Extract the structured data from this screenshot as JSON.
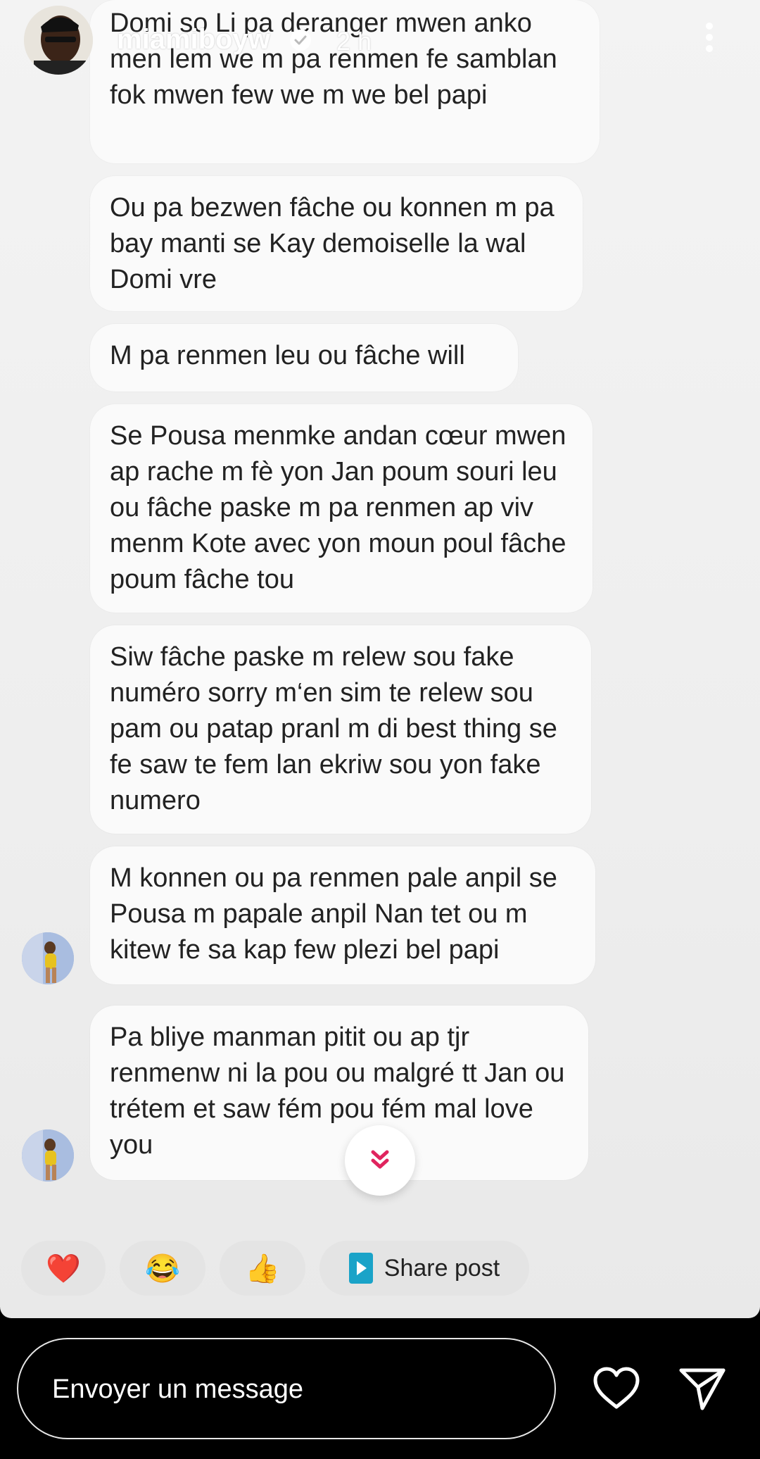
{
  "header": {
    "username": "miamiboyw",
    "time": "2 h"
  },
  "messages": [
    {
      "text": "Domi so Li pa deranger mwen anko men lem we m pa renmen fe samblan fok mwen few we m we bel papi"
    },
    {
      "text": "Ou pa bezwen fâche  ou konnen m pa bay manti se Kay demoiselle la wal Domi vre"
    },
    {
      "text": "M pa renmen leu ou fâche will"
    },
    {
      "text": "Se Pousa menmke andan cœur mwen ap rache m fè yon Jan poum souri leu ou fâche paske m pa renmen ap viv menm Kote avec yon moun poul fâche poum fâche tou"
    },
    {
      "text": "Siw fâche paske m relew sou fake numéro sorry m‘en sim te relew sou pam ou patap pranl m di best thing se fe saw te fem lan ekriw sou yon fake numero"
    },
    {
      "text": "M konnen ou pa renmen pale anpil se Pousa m papale anpil Nan tet ou m kitew fe sa kap few plezi bel papi"
    },
    {
      "text": "Pa bliye manman pitit ou ap tjr renmenw ni la pou ou malgré tt Jan ou trétem et saw fém pou fém mal love you"
    }
  ],
  "reactions": {
    "heart": "❤️",
    "laugh": "😂",
    "thumbs": "👍",
    "share_label": "Share post"
  },
  "composer": {
    "placeholder": "Envoyer un message"
  },
  "colors": {
    "background": "#f0f0f0",
    "bubble": "#fafafa",
    "chip": "#e4e4e4",
    "accent_red": "#e0245e",
    "share_icon": "#1aa3c8"
  },
  "icons": [
    "verified-badge-icon",
    "more-options-icon",
    "chevron-double-down-icon",
    "heart-icon",
    "send-icon",
    "play-icon"
  ]
}
